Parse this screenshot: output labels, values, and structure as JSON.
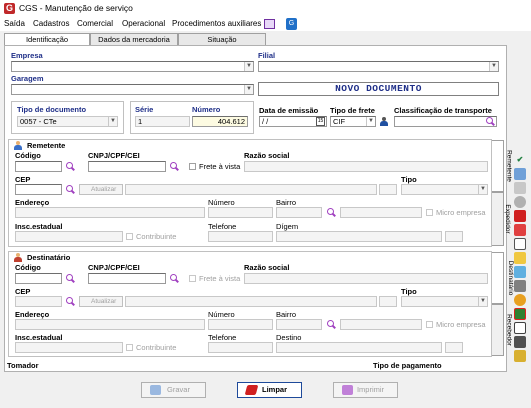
{
  "window": {
    "title": "CGS - Manutenção de serviço"
  },
  "menu": [
    "Saída",
    "Cadastros",
    "Comercial",
    "Operacional",
    "Procedimentos auxiliares"
  ],
  "tabs": [
    "Identificação",
    "Dados da mercadoria",
    "Situação"
  ],
  "empresa": {
    "label": "Empresa",
    "value": ""
  },
  "filial": {
    "label": "Filial",
    "value": ""
  },
  "garagem": {
    "label": "Garagem",
    "value": ""
  },
  "status_banner": "NOVO DOCUMENTO",
  "tipo_documento": {
    "label": "Tipo de documento",
    "value": "0057 - CTe"
  },
  "serie": {
    "label": "Série",
    "value": "1"
  },
  "numero": {
    "label": "Número",
    "value": "404.612"
  },
  "data_emissao": {
    "label": "Data de emissão",
    "value": " / /"
  },
  "tipo_frete": {
    "label": "Tipo de frete",
    "value": "CIF"
  },
  "classificacao": {
    "label": "Classificação de transporte",
    "value": ""
  },
  "remetente": {
    "header": "Remetente",
    "codigo": "Código",
    "cnpj": "CNPJ/CPF/CEI",
    "frete_a_vista": "Frete à vista",
    "razao_social": "Razão social",
    "cep": "CEP",
    "atualizar": "Atualizar",
    "tipo": "Tipo",
    "endereco": "Endereço",
    "numero": "Número",
    "bairro": "Bairro",
    "micro_empresa": "Micro empresa",
    "insc_estadual": "Insc.estadual",
    "contribuinte": "Contribuinte",
    "telefone": "Telefone",
    "extra": "Dígem"
  },
  "destinatario": {
    "header": "Destinatário",
    "codigo": "Código",
    "cnpj": "CNPJ/CPF/CEI",
    "frete_a_vista": "Frete à vista",
    "razao_social": "Razão social",
    "cep": "CEP",
    "atualizar": "Atualizar",
    "tipo": "Tipo",
    "endereco": "Endereço",
    "numero": "Número",
    "bairro": "Bairro",
    "micro_empresa": "Micro empresa",
    "insc_estadual": "Insc.estadual",
    "contribuinte": "Contribuinte",
    "telefone": "Telefone",
    "extra": "Destino"
  },
  "side_tabs": [
    "Remetente",
    "Expedidor",
    "Destinatário",
    "Recebedor"
  ],
  "footer": {
    "tomador": "Tomador",
    "tipo_pagamento": "Tipo de pagamento"
  },
  "buttons": {
    "gravar": "Gravar",
    "limpar": "Limpar",
    "imprimir": "Imprimir"
  },
  "toolbar_icons": [
    "check-icon",
    "settings-icon",
    "ser-icon",
    "circle-icon",
    "cube-icon",
    "export-icon",
    "document-icon",
    "folder-icon",
    "map-icon",
    "truck-icon",
    "globe-icon",
    "edit-icon",
    "copy-icon",
    "print-icon",
    "group-icon"
  ]
}
